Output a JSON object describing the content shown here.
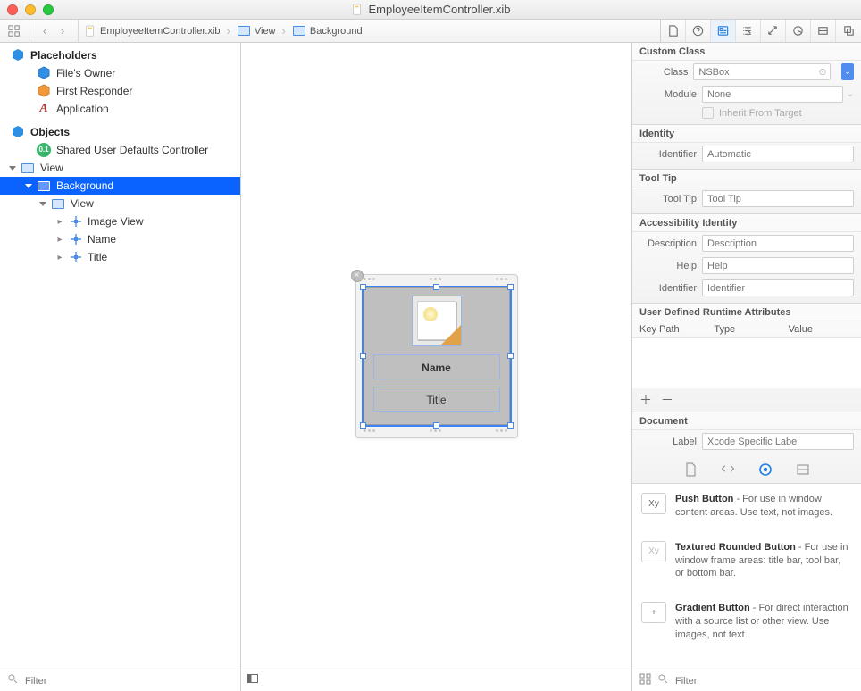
{
  "window": {
    "title": "EmployeeItemController.xib"
  },
  "jumpbar": {
    "file": "EmployeeItemController.xib",
    "view": "View",
    "background": "Background"
  },
  "outline": {
    "placeholders_header": "Placeholders",
    "files_owner": "File's Owner",
    "first_responder": "First Responder",
    "application": "Application",
    "objects_header": "Objects",
    "shared_defaults": "Shared User Defaults Controller",
    "view": "View",
    "background": "Background",
    "inner_view": "View",
    "image_view": "Image View",
    "name": "Name",
    "title": "Title",
    "filter_placeholder": "Filter"
  },
  "canvas": {
    "name_label": "Name",
    "title_label": "Title"
  },
  "inspector": {
    "custom_class": {
      "title": "Custom Class",
      "class_label": "Class",
      "class_value": "NSBox",
      "module_label": "Module",
      "module_value": "None",
      "inherit": "Inherit From Target"
    },
    "identity": {
      "title": "Identity",
      "identifier_label": "Identifier",
      "identifier_placeholder": "Automatic"
    },
    "tooltip": {
      "title": "Tool Tip",
      "label": "Tool Tip",
      "placeholder": "Tool Tip"
    },
    "accessibility": {
      "title": "Accessibility Identity",
      "description_label": "Description",
      "description_placeholder": "Description",
      "help_label": "Help",
      "help_placeholder": "Help",
      "identifier_label": "Identifier",
      "identifier_placeholder": "Identifier"
    },
    "udra": {
      "title": "User Defined Runtime Attributes",
      "keypath": "Key Path",
      "type": "Type",
      "value": "Value"
    },
    "document": {
      "title": "Document",
      "label_label": "Label",
      "label_placeholder": "Xcode Specific Label"
    },
    "library": {
      "push_title": "Push Button",
      "push_desc": " - For use in window content areas. Use text, not images.",
      "tex_title": "Textured Rounded Button",
      "tex_desc": " - For use in window frame areas: title bar, tool bar, or bottom bar.",
      "grad_title": "Gradient Button",
      "grad_desc": " - For direct interaction with a source list or other view. Use images, not text.",
      "thumb_xy": "Xy",
      "thumb_plus": "+"
    },
    "footer_filter_placeholder": "Filter"
  }
}
